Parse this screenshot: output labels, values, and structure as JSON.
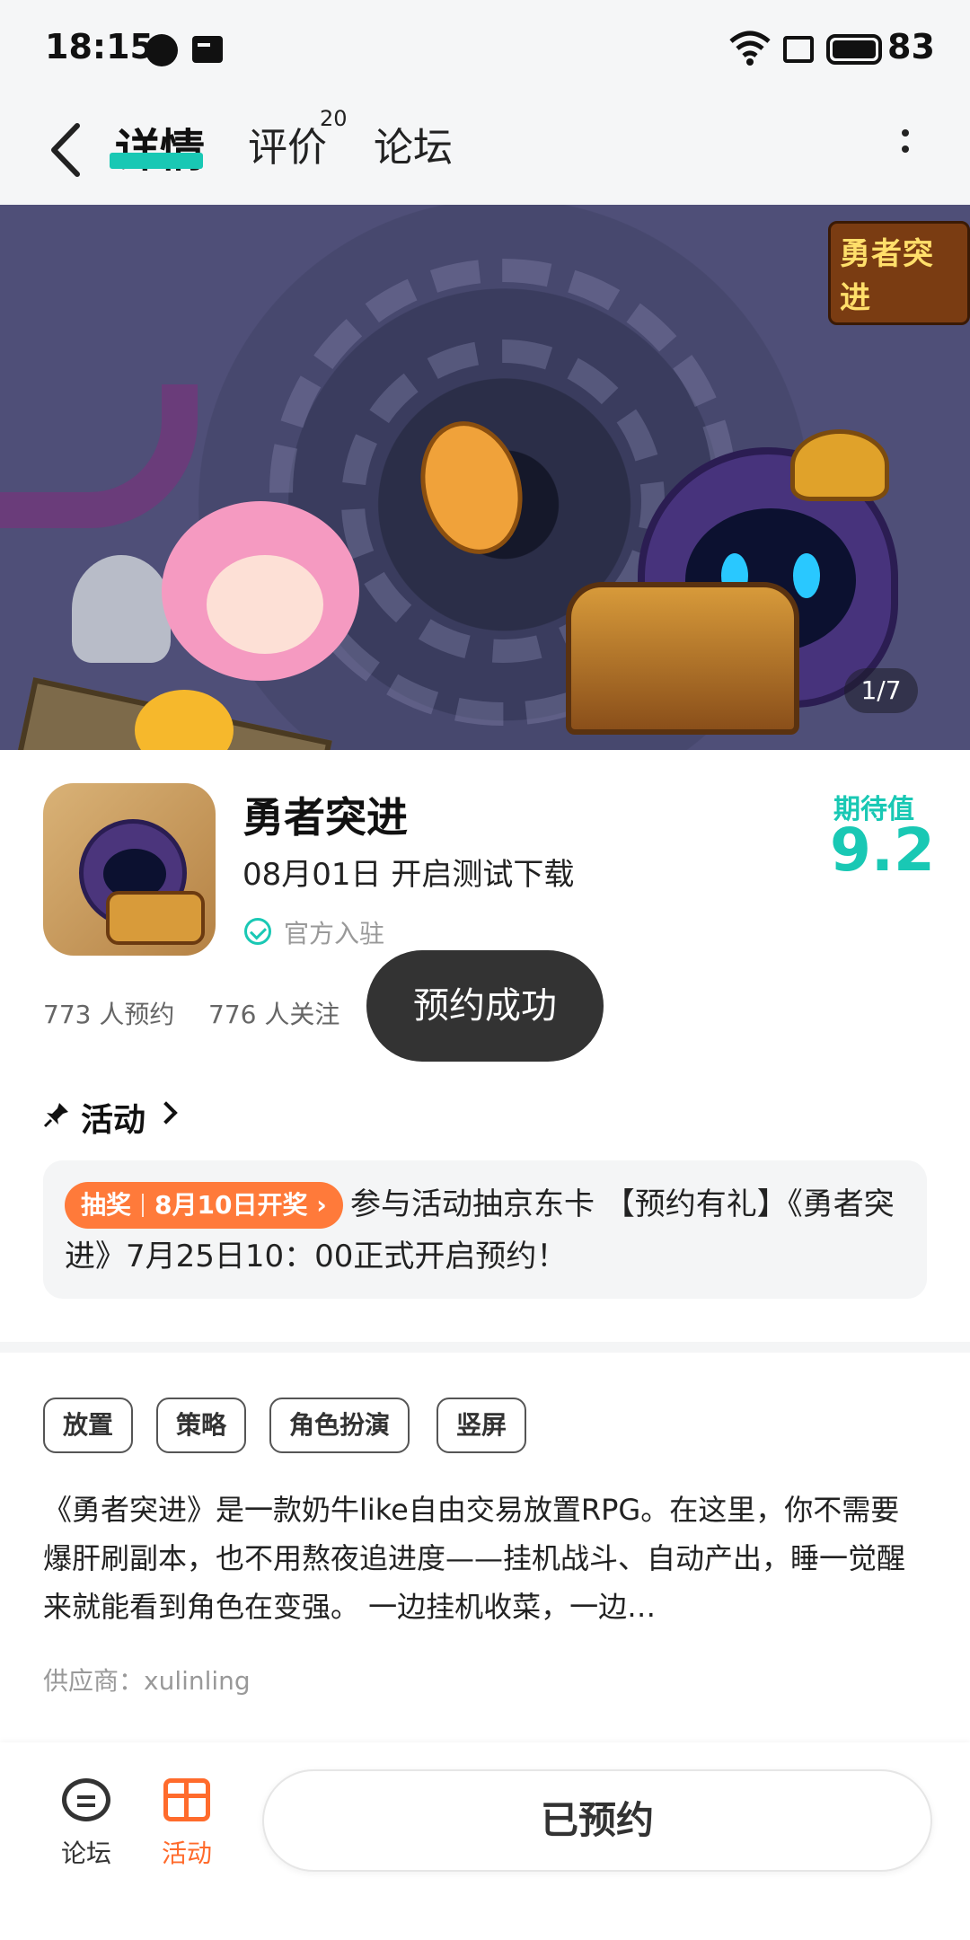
{
  "status_bar": {
    "time": "18:15",
    "battery": "83"
  },
  "nav": {
    "tabs": [
      {
        "label": "详情",
        "active": true
      },
      {
        "label": "评价",
        "badge": "20"
      },
      {
        "label": "论坛"
      }
    ],
    "accent_color": "#19c8b4"
  },
  "hero": {
    "logo_text": "勇者突进",
    "counter": "1/7"
  },
  "game": {
    "name": "勇者突进",
    "test_info": "08月01日 开启测试下载",
    "official_label": "官方入驻",
    "expect_label": "期待值",
    "expect_value": "9.2",
    "reserve_count": "773 人预约",
    "follow_count": "776 人关注"
  },
  "toast": "预约成功",
  "activity": {
    "title": "活动",
    "badge_type": "抽奖",
    "badge_date": "8月10日开奖",
    "text": "参与活动抽京东卡 【预约有礼】《勇者突进》7月25日10：00正式开启预约！",
    "badge_color": "#ff7a3a"
  },
  "tags": [
    "放置",
    "策略",
    "角色扮演",
    "竖屏"
  ],
  "description": "《勇者突进》是一款奶牛like自由交易放置RPG。在这里，你不需要爆肝刷副本，也不用熬夜追进度——挂机战斗、自动产出，睡一觉醒来就能看到角色在变强。 一边挂机收菜，一边…",
  "supplier": "供应商：xulinling",
  "bottom_bar": {
    "forum_label": "论坛",
    "activity_label": "活动",
    "reserved_label": "已预约",
    "activity_color": "#ff6b2c"
  }
}
